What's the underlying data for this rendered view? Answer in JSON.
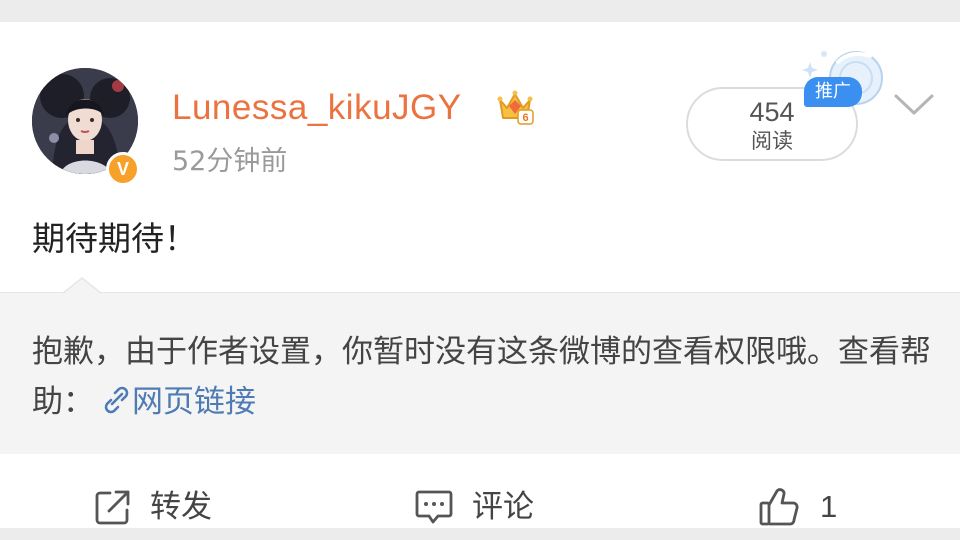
{
  "post": {
    "author": {
      "name": "Lunessa_kikuJGY",
      "verified_badge": "V",
      "level_badge": "6",
      "avatar": "avatar-portrait"
    },
    "time": "52分钟前",
    "reads": {
      "count": "454",
      "label": "阅读"
    },
    "promo_badge": "推广",
    "text": "期待期待！"
  },
  "notice": {
    "text": "抱歉，由于作者设置，你暂时没有这条微博的查看权限哦。查看帮助：",
    "link_icon": "link-icon",
    "link_label": "网页链接"
  },
  "actions": {
    "repost": {
      "label": "转发",
      "icon": "share-icon"
    },
    "comment": {
      "label": "评论",
      "icon": "comment-icon"
    },
    "like": {
      "count": "1",
      "icon": "thumbs-up-icon"
    }
  },
  "colors": {
    "username": "#eb7340",
    "link": "#4f7bb5",
    "promo": "#3a8ff0",
    "verified": "#f7a12b"
  }
}
